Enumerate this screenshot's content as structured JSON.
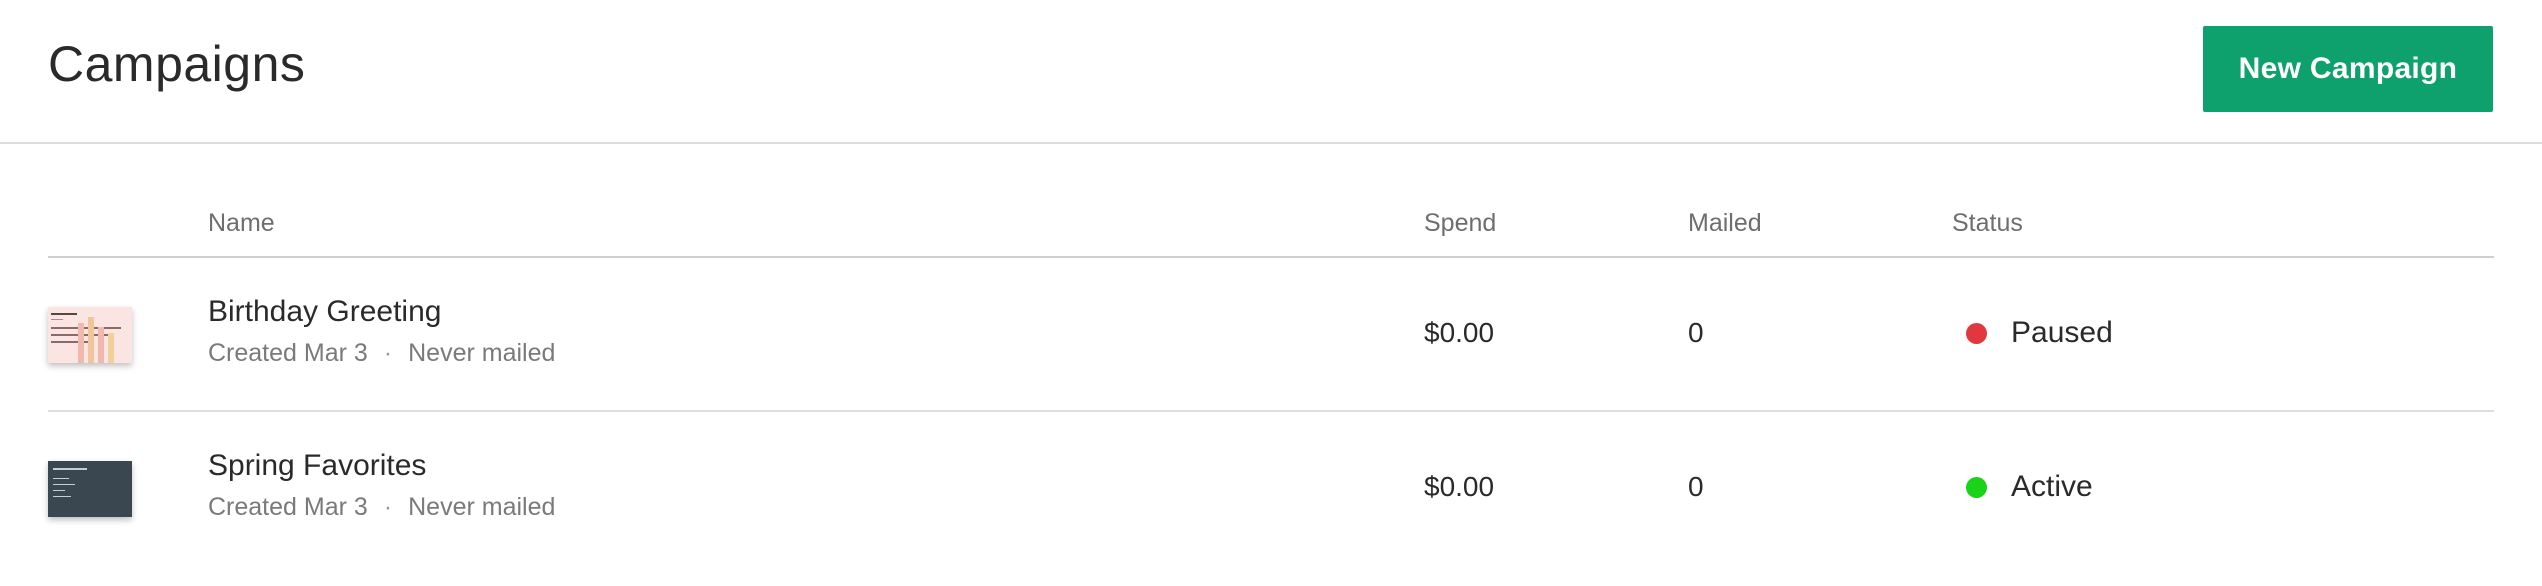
{
  "header": {
    "title": "Campaigns",
    "new_button_label": "New Campaign",
    "button_color": "#0ea06d"
  },
  "table": {
    "columns": {
      "name": "Name",
      "spend": "Spend",
      "mailed": "Mailed",
      "status": "Status"
    },
    "rows": [
      {
        "name": "Birthday Greeting",
        "created": "Created Mar 3",
        "separator": "·",
        "mailed_info": "Never mailed",
        "spend": "$0.00",
        "mailed": "0",
        "status": "Paused",
        "status_color": "#e0383e",
        "thumbnail": "birthday-card-thumbnail"
      },
      {
        "name": "Spring Favorites",
        "created": "Created Mar 3",
        "separator": "·",
        "mailed_info": "Never mailed",
        "spend": "$0.00",
        "mailed": "0",
        "status": "Active",
        "status_color": "#19d219",
        "thumbnail": "postcard-template-thumbnail"
      }
    ]
  }
}
